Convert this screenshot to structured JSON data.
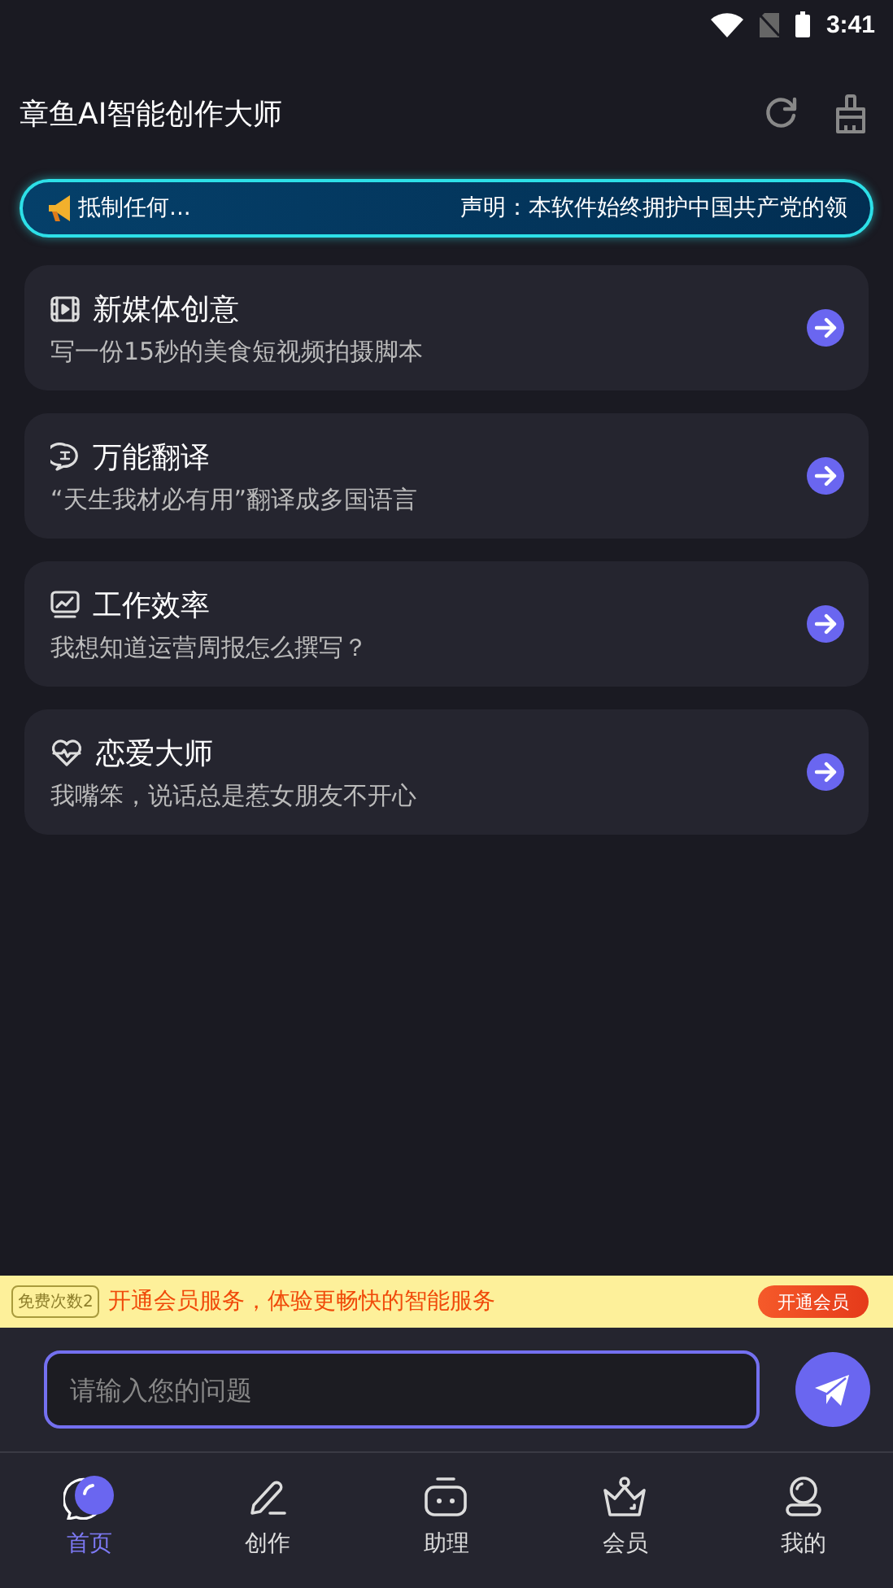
{
  "status_bar": {
    "time": "3:41"
  },
  "header": {
    "title": "章鱼AI智能创作大师"
  },
  "notice": {
    "texts": [
      "抵制任何...",
      "声明：本软件始终拥护中国共产党的领"
    ]
  },
  "cards": [
    {
      "kind": "media",
      "title": "新媒体创意",
      "prompt": "写一份15秒的美食短视频拍摄脚本"
    },
    {
      "kind": "translate",
      "title": "万能翻译",
      "prompt": "“天生我材必有用”翻译成多国语言"
    },
    {
      "kind": "chart",
      "title": "工作效率",
      "prompt": "我想知道运营周报怎么撰写？"
    },
    {
      "kind": "heart",
      "title": "恋爱大师",
      "prompt": "我嘴笨，说话总是惹女朋友不开心"
    }
  ],
  "promo": {
    "badge": "免费次数2",
    "text": "开通会员服务，体验更畅快的智能服务",
    "button": "开通会员"
  },
  "input": {
    "placeholder": "请输入您的问题"
  },
  "tabs": [
    {
      "kind": "home",
      "label": "首页",
      "selected": true
    },
    {
      "kind": "create",
      "label": "创作",
      "selected": false
    },
    {
      "kind": "assistant",
      "label": "助理",
      "selected": false
    },
    {
      "kind": "vip",
      "label": "会员",
      "selected": false
    },
    {
      "kind": "profile",
      "label": "我的",
      "selected": false
    }
  ]
}
